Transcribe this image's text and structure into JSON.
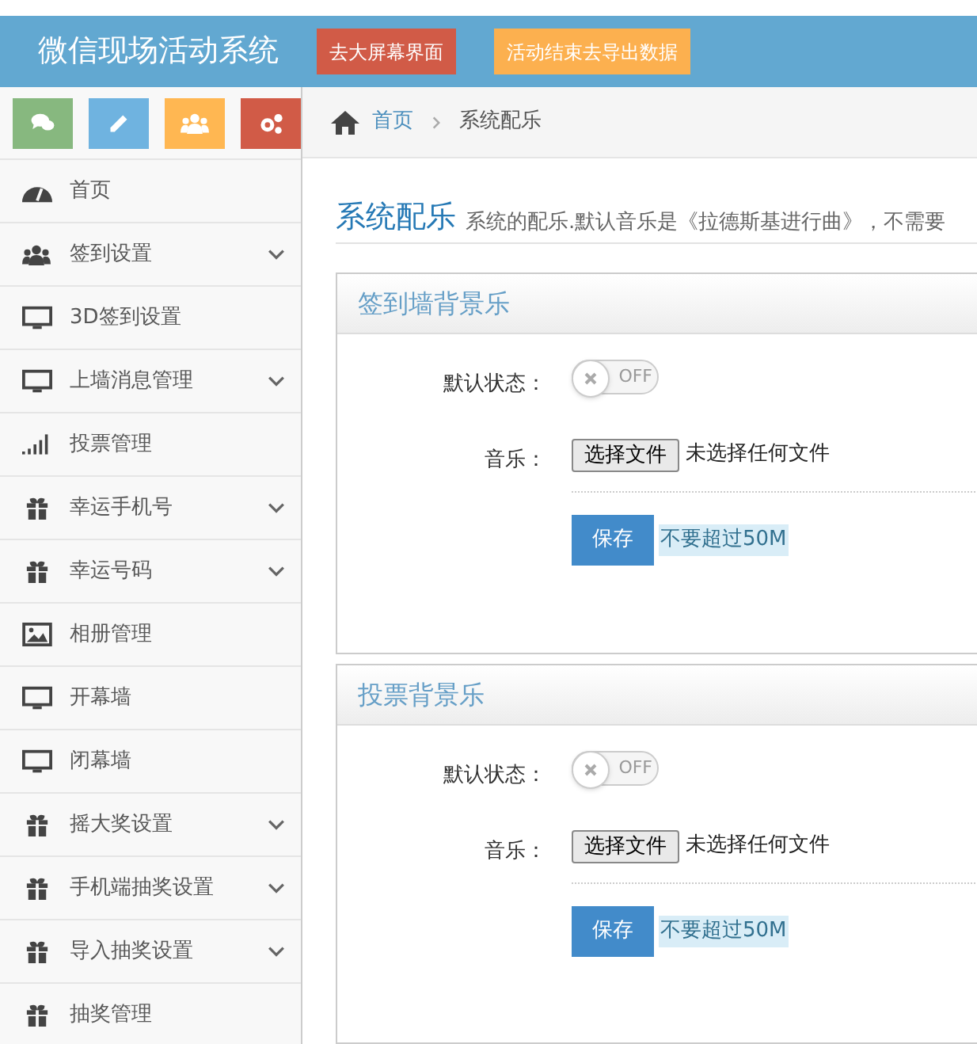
{
  "header": {
    "title": "微信现场活动系统",
    "buttons": [
      {
        "label": "去大屏幕界面",
        "color": "#d15b47"
      },
      {
        "label": "活动结束去导出数据",
        "color": "#fcb04f"
      }
    ]
  },
  "shortcuts": [
    {
      "kind": "chat",
      "color": "#87b87f"
    },
    {
      "kind": "pencil",
      "color": "#6fb3e0"
    },
    {
      "kind": "users",
      "color": "#ffb752"
    },
    {
      "kind": "gears",
      "color": "#d15b47"
    }
  ],
  "sidebar": {
    "items": [
      {
        "label": "首页",
        "kind": "dashboard",
        "expandable": false
      },
      {
        "label": "签到设置",
        "kind": "users",
        "expandable": true
      },
      {
        "label": "3D签到设置",
        "kind": "monitor",
        "expandable": false
      },
      {
        "label": "上墙消息管理",
        "kind": "monitor",
        "expandable": true
      },
      {
        "label": "投票管理",
        "kind": "signal",
        "expandable": false
      },
      {
        "label": "幸运手机号",
        "kind": "gift",
        "expandable": true
      },
      {
        "label": "幸运号码",
        "kind": "gift",
        "expandable": true
      },
      {
        "label": "相册管理",
        "kind": "image",
        "expandable": false
      },
      {
        "label": "开幕墙",
        "kind": "monitor",
        "expandable": false
      },
      {
        "label": "闭幕墙",
        "kind": "monitor",
        "expandable": false
      },
      {
        "label": "摇大奖设置",
        "kind": "gift",
        "expandable": true
      },
      {
        "label": "手机端抽奖设置",
        "kind": "gift",
        "expandable": true
      },
      {
        "label": "导入抽奖设置",
        "kind": "gift",
        "expandable": true
      },
      {
        "label": "抽奖管理",
        "kind": "gift",
        "expandable": false
      }
    ]
  },
  "breadcrumb": [
    {
      "label": "首页",
      "link": true
    },
    {
      "label": "系统配乐",
      "link": false
    }
  ],
  "page": {
    "title": "系统配乐",
    "subtitle": "系统的配乐.默认音乐是《拉德斯基进行曲》，不需要"
  },
  "panels": [
    {
      "title": "签到墙背景乐",
      "status_label": "默认状态：",
      "toggle": {
        "on": false,
        "label": "OFF"
      },
      "music_label": "音乐：",
      "file_button": "选择文件",
      "file_status": "未选择任何文件",
      "save": "保存",
      "hint": "不要超过50M"
    },
    {
      "title": "投票背景乐",
      "status_label": "默认状态：",
      "toggle": {
        "on": false,
        "label": "OFF"
      },
      "music_label": "音乐：",
      "file_button": "选择文件",
      "file_status": "未选择任何文件",
      "save": "保存",
      "hint": "不要超过50M"
    }
  ]
}
